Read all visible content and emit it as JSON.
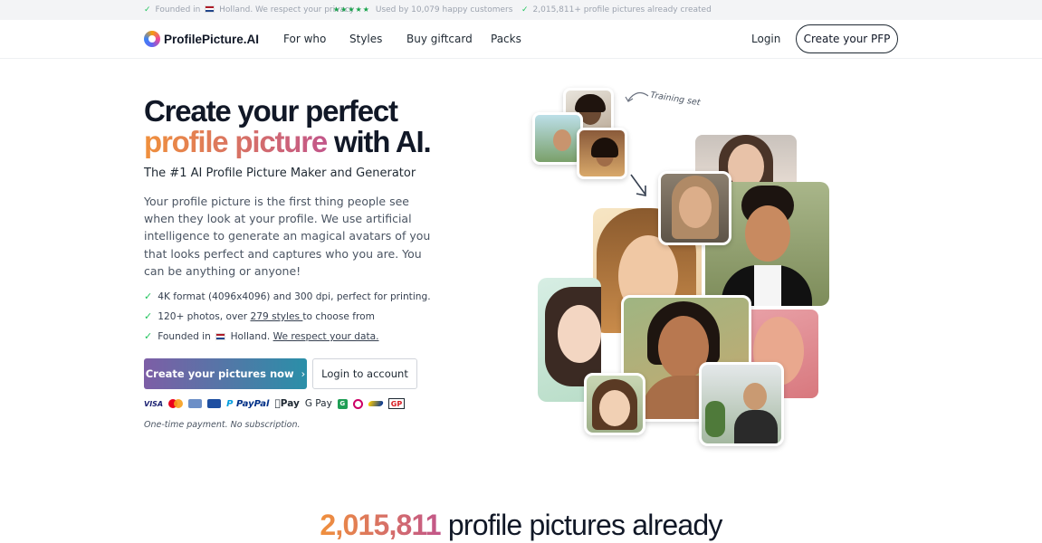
{
  "topbar": {
    "founded_prefix": "Founded in",
    "founded_suffix": "Holland. We respect your privacy",
    "rating_stars": "★★★★★",
    "used_by": "Used by 10,079 happy customers",
    "created": "2,015,811+ profile pictures already created"
  },
  "brand": {
    "name": "ProfilePicture.AI",
    "gradient_start": "#f0903c",
    "gradient_end": "#c2568a"
  },
  "nav": {
    "links": [
      "For who",
      "Styles",
      "Buy giftcard",
      "Packs"
    ],
    "login": "Login",
    "cta": "Create your PFP"
  },
  "hero": {
    "title_line1": "Create your perfect",
    "title_highlight": "profile picture",
    "title_line2_rest": " with AI.",
    "subtitle": "The #1 AI Profile Picture Maker and Generator",
    "description": "Your profile picture is the first thing people see when they look at your profile. We use artificial intelligence to generate an magical avatars of you that looks perfect and captures who you are. You can be anything or anyone!",
    "features": [
      {
        "text": "4K format (4096x4096) and 300 dpi, perfect for printing."
      },
      {
        "before": "120+ photos, over ",
        "link": "279 styles ",
        "after": "to choose from"
      },
      {
        "before": "Founded in",
        "after": "Holland. ",
        "link": "We respect your data."
      }
    ],
    "primary_button": "Create your pictures now",
    "primary_button_chevron": "›",
    "secondary_button": "Login to account",
    "payment_methods": [
      "VISA",
      "Mastercard",
      "Maestro",
      "Amex",
      "PayPal",
      "Apple Pay",
      "G Pay",
      "G",
      "iDEAL",
      "Swish",
      "GP"
    ],
    "payment_labels": {
      "visa": "VISA",
      "paypal_p": "P",
      "paypal": "PayPal",
      "apple": " Pay",
      "google": "G Pay",
      "g": "G",
      "gp": "GP"
    },
    "payment_note": "One-time payment. No subscription."
  },
  "collage": {
    "training_label": "Training set"
  },
  "stats": {
    "count": "2,015,811",
    "text": " profile pictures already"
  },
  "icons": {
    "check": "✓",
    "arrow_right": "›"
  }
}
